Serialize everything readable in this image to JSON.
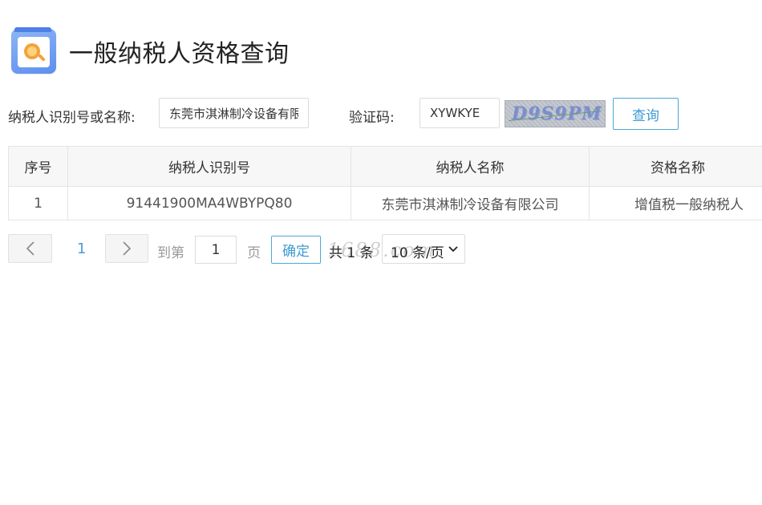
{
  "page": {
    "title": "一般纳税人资格查询"
  },
  "form": {
    "taxpayer_label": "纳税人识别号或名称:",
    "taxpayer_value": "东莞市淇淋制冷设备有限公司",
    "captcha_label": "验证码:",
    "captcha_value": "XYWKYE",
    "captcha_image_text": "D9S9PM",
    "query_button": "查询"
  },
  "table": {
    "headers": [
      "序号",
      "纳税人识别号",
      "纳税人名称",
      "资格名称"
    ],
    "rows": [
      [
        "1",
        "91441900MA4WBYPQ80",
        "东莞市淇淋制冷设备有限公司",
        "增值税一般纳税人"
      ]
    ]
  },
  "pagination": {
    "current_page": "1",
    "goto_label": "到第",
    "goto_value": "1",
    "page_suffix": "页",
    "confirm_button": "确定",
    "total_text": "共 1 条",
    "page_size": "10 条/页"
  },
  "watermark": "1688.com",
  "colors": {
    "accent": "#3d9bd3",
    "border": "#e4e4e4",
    "header_bg": "#f7f7f7"
  }
}
